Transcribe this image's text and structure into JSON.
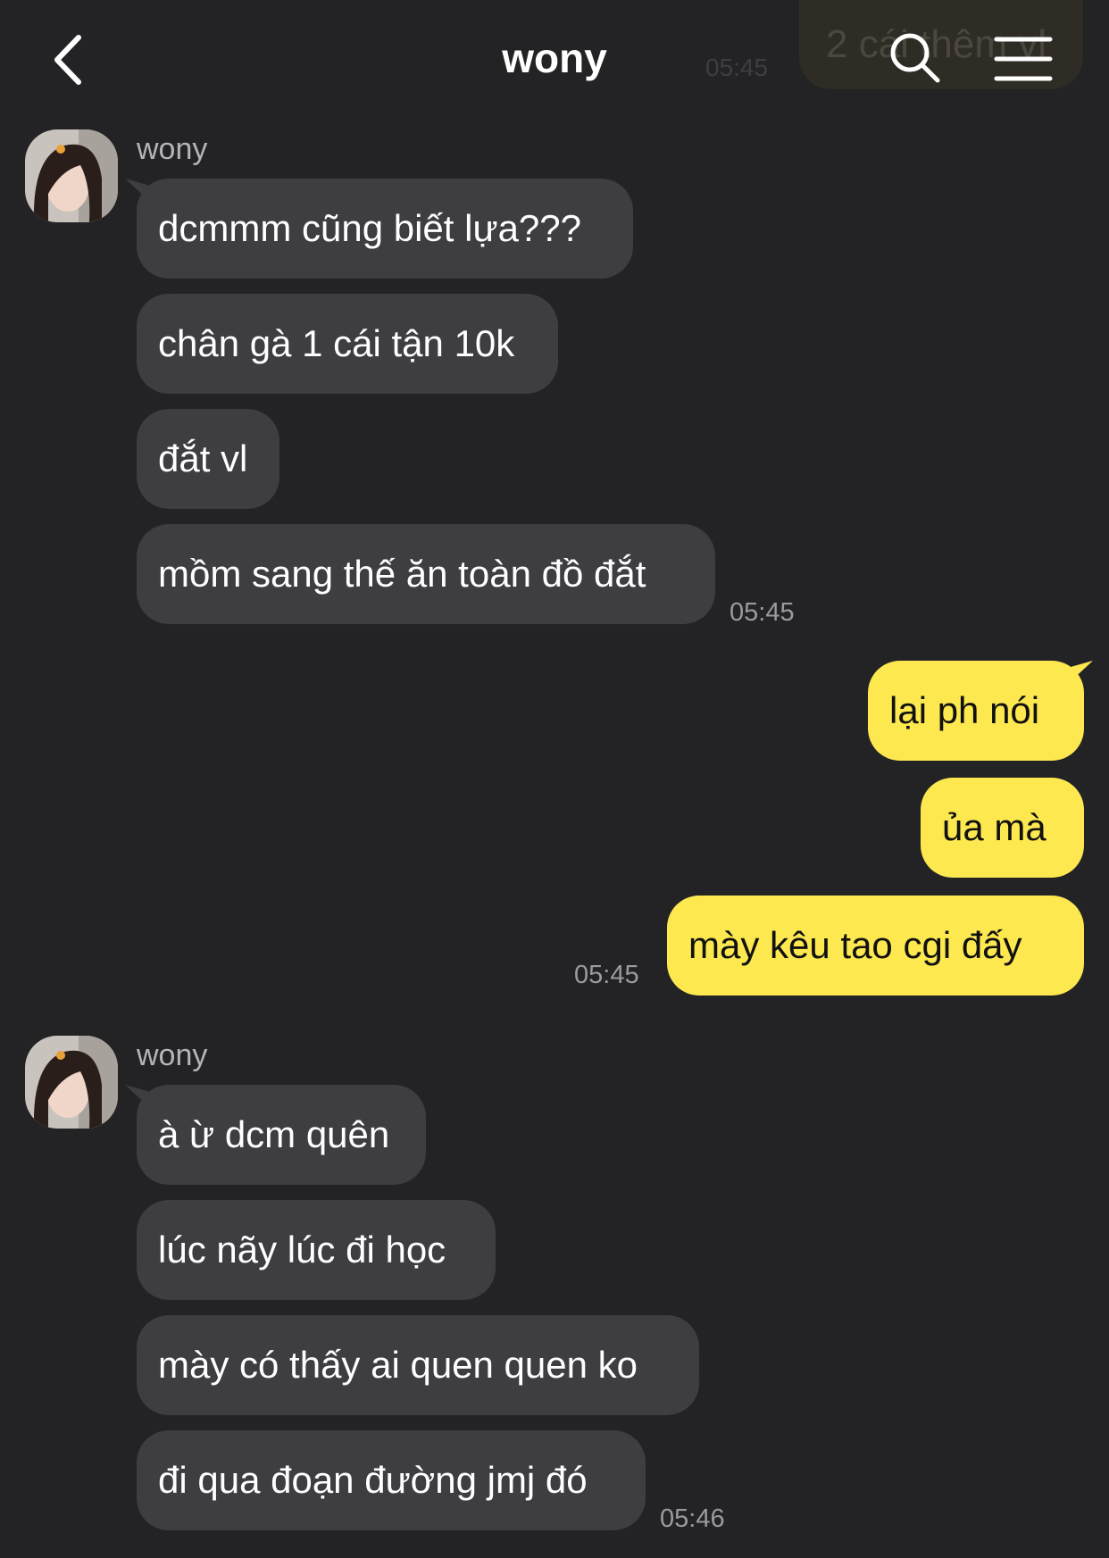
{
  "header": {
    "title": "wony",
    "back_icon": "chevron-left-icon",
    "search_icon": "search-icon",
    "menu_icon": "hamburger-menu-icon"
  },
  "ghost": {
    "text": "2 cái thêm vl",
    "time": "05:45"
  },
  "groups": [
    {
      "sender": "wony",
      "messages": [
        "dcmmm cũng biết lựa???",
        "chân gà 1 cái tận 10k",
        "đắt vl",
        "mồm sang thế ăn toàn đồ đắt"
      ],
      "time": "05:45"
    },
    {
      "sender": "me",
      "messages": [
        "lại ph nói",
        "ủa mà",
        "mày kêu tao cgi đấy"
      ],
      "time": "05:45"
    },
    {
      "sender": "wony",
      "messages": [
        "à ừ dcm quên",
        "lúc nãy lúc đi học",
        "mày có thấy ai quen quen ko",
        "đi qua đoạn đường jmj đó"
      ],
      "time": "05:46"
    }
  ],
  "colors": {
    "background": "#232326",
    "incoming_bubble": "#3d3d42",
    "outgoing_bubble": "#fde84f"
  }
}
